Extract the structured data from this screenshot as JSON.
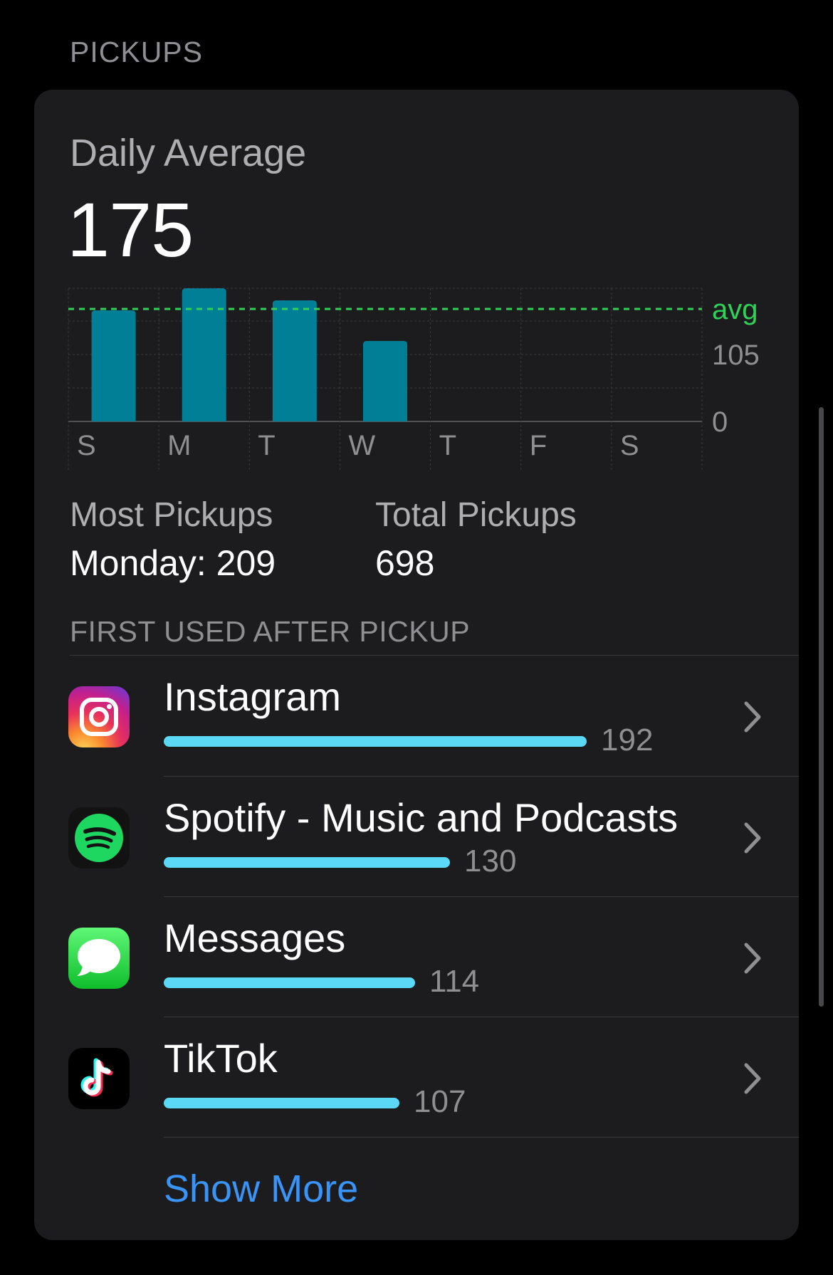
{
  "section_title": "PICKUPS",
  "daily_average": {
    "label": "Daily Average",
    "value": "175"
  },
  "chart_data": {
    "type": "bar",
    "categories": [
      "S",
      "M",
      "T",
      "W",
      "T",
      "F",
      "S"
    ],
    "values": [
      156,
      187,
      170,
      113,
      null,
      null,
      null
    ],
    "y_ticks": [
      "105",
      "0"
    ],
    "average_label": "avg",
    "average_value": 158,
    "ylim": [
      0,
      187
    ],
    "grid": true,
    "bar_color": "#007f96",
    "avg_line_color": "#30d158"
  },
  "stats": {
    "most_pickups_label": "Most Pickups",
    "most_pickups_value": "Monday: 209",
    "total_pickups_label": "Total Pickups",
    "total_pickups_value": "698"
  },
  "first_used": {
    "header": "FIRST USED AFTER PICKUP",
    "apps": [
      {
        "name": "Instagram",
        "count": "192",
        "value": 192,
        "icon": "instagram-icon"
      },
      {
        "name": "Spotify - Music and Podcasts",
        "count": "130",
        "value": 130,
        "icon": "spotify-icon"
      },
      {
        "name": "Messages",
        "count": "114",
        "value": 114,
        "icon": "messages-icon"
      },
      {
        "name": "TikTok",
        "count": "107",
        "value": 107,
        "icon": "tiktok-icon"
      }
    ],
    "show_more": "Show More"
  },
  "colors": {
    "accent_link": "#3a94f5",
    "usage_bar": "#5ad8f5"
  }
}
